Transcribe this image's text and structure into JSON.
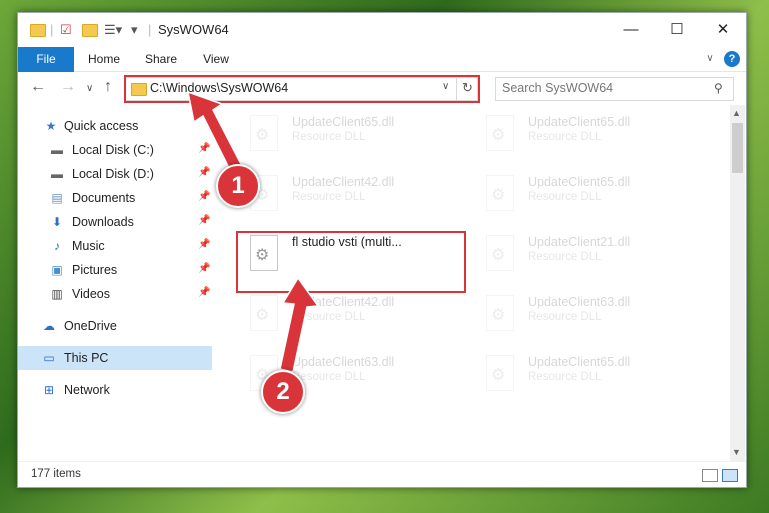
{
  "window": {
    "title": "SysWOW64",
    "controls": [
      "—",
      "☐",
      "✕"
    ]
  },
  "ribbon": {
    "tabs": [
      "File",
      "Home",
      "Share",
      "View"
    ],
    "help": "?"
  },
  "address": {
    "path": "C:\\Windows\\SysWOW64",
    "search_placeholder": "Search SysWOW64"
  },
  "sidebar": {
    "items": [
      {
        "label": "Quick access",
        "icon": "star-icon",
        "pinned": false
      },
      {
        "label": "Local Disk (C:)",
        "icon": "drive-icon",
        "pinned": true
      },
      {
        "label": "Local Disk (D:)",
        "icon": "drive-icon",
        "pinned": true
      },
      {
        "label": "Documents",
        "icon": "documents-icon",
        "pinned": true
      },
      {
        "label": "Downloads",
        "icon": "download-icon",
        "pinned": true
      },
      {
        "label": "Music",
        "icon": "music-icon",
        "pinned": true
      },
      {
        "label": "Pictures",
        "icon": "pictures-icon",
        "pinned": true
      },
      {
        "label": "Videos",
        "icon": "videos-icon",
        "pinned": true
      },
      {
        "label": "OneDrive",
        "icon": "cloud-icon",
        "pinned": false
      },
      {
        "label": "This PC",
        "icon": "computer-icon",
        "pinned": false,
        "selected": true
      },
      {
        "label": "Network",
        "icon": "network-icon",
        "pinned": false
      }
    ]
  },
  "files": [
    {
      "name": "UpdateClient65.dll",
      "type": "Resource DLL"
    },
    {
      "name": "UpdateClient65.dll",
      "type": "Resource DLL"
    },
    {
      "name": "UpdateClient42.dll",
      "type": "Resource DLL"
    },
    {
      "name": "UpdateClient65.dll",
      "type": "Resource DLL"
    },
    {
      "name": "fl studio vsti (multi...",
      "type": ""
    },
    {
      "name": "UpdateClient21.dll",
      "type": "Resource DLL"
    },
    {
      "name": "UpdateClient42.dll",
      "type": "Resource DLL"
    },
    {
      "name": "UpdateClient63.dll",
      "type": "Resource DLL"
    },
    {
      "name": "UpdateClient63.dll",
      "type": "Resource DLL"
    },
    {
      "name": "UpdateClient65.dll",
      "type": "Resource DLL"
    }
  ],
  "status": {
    "item_count": "177 items"
  },
  "callouts": [
    "1",
    "2"
  ],
  "colors": {
    "accent": "#1979ca",
    "highlight": "#d9343a",
    "selected": "#cce4f7"
  }
}
